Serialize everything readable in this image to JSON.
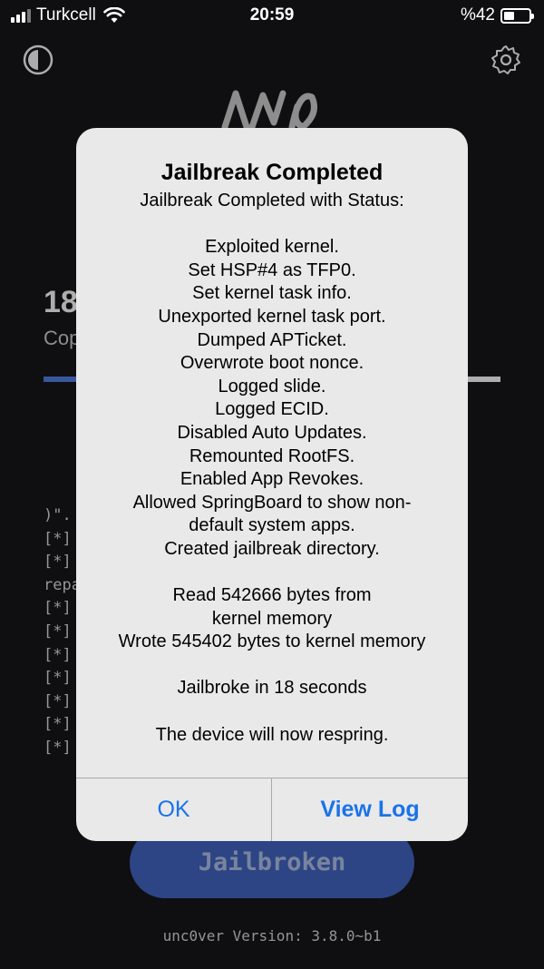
{
  "status_bar": {
    "carrier": "Turkcell",
    "time": "20:59",
    "battery_label": "%42",
    "battery_level": 0.42
  },
  "app": {
    "background_number": "18",
    "background_subtitle": "Cop",
    "log_lines": [
      ")\".",
      "[*]",
      "[*]",
      "repa",
      "[*]",
      "[*]",
      "[*]",
      "[*]",
      "[*]",
      "[*]",
      "[*]"
    ],
    "jailbreak_button_label": "Jailbroken",
    "version_text": "unc0ver Version: 3.8.0~b1"
  },
  "alert": {
    "title": "Jailbreak Completed",
    "message_lines": [
      "Jailbreak Completed with Status:",
      "",
      "Exploited kernel.",
      "Set HSP#4 as TFP0.",
      "Set kernel task info.",
      "Unexported kernel task port.",
      "Dumped APTicket.",
      "Overwrote boot nonce.",
      "Logged slide.",
      "Logged ECID.",
      "Disabled Auto Updates.",
      "Remounted RootFS.",
      "Enabled App Revokes.",
      "Allowed SpringBoard to show non-",
      "default system apps.",
      "Created jailbreak directory.",
      "",
      "Read 542666 bytes from",
      "kernel memory",
      "Wrote 545402 bytes to kernel memory",
      "",
      "Jailbroke in 18 seconds",
      "",
      "The device will now respring."
    ],
    "ok_label": "OK",
    "view_log_label": "View Log"
  },
  "colors": {
    "accent": "#1a73e8",
    "button_blue": "#3c5db0",
    "alert_bg": "#e9e9ea",
    "background": "#141418"
  }
}
